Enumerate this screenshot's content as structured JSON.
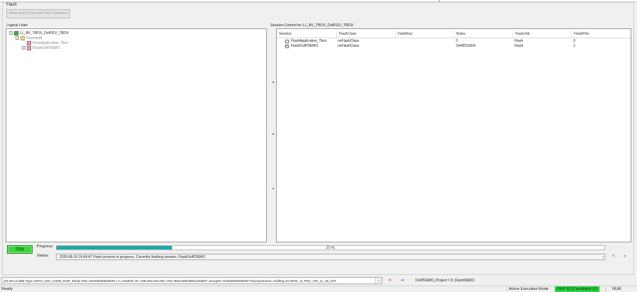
{
  "window": {
    "group_title": "Flash",
    "show_only_button": "Show only ECUs with Flash Sessions"
  },
  "logical_links": {
    "label": "Logical Links",
    "tree": [
      {
        "label": "LL_BV_TBOX_DoIP.EV_TBOX",
        "expander": "−"
      },
      {
        "label": "Download",
        "expander": "−"
      },
      {
        "label": "FlashApplication_Tbox",
        "expander": ""
      },
      {
        "label": "FlashDoIPDEMO",
        "expander": "+"
      }
    ]
  },
  "session_control": {
    "label": "Session Control for LL_BV_TBOX_DoIP.EV_TBOX",
    "columns": [
      "Session",
      "FlashClass",
      "FlashKey",
      "Bytes",
      "FlashJob",
      "FlashPrio"
    ],
    "rows": [
      {
        "checked": false,
        "session": "FlashApplication_Tbox",
        "flashclass": "noFlashClass",
        "flashkey": "",
        "bytes": "0",
        "flashjob": "Flash",
        "flashprio": "0"
      },
      {
        "checked": true,
        "session": "FlashDoIPDEMO",
        "flashclass": "noFlashClass",
        "flashkey": "",
        "bytes": "1549531004",
        "flashjob": "Flash",
        "flashprio": "1"
      }
    ]
  },
  "progress": {
    "stop_label": "Stop",
    "progress_label": "Progress:",
    "percent": 21,
    "percent_text": "21 %",
    "status_label": "Status:",
    "status_text": "2020-06-19 16:49:47  Flash process in progress. Currently flashing session: FlashDoIPDEMO"
  },
  "connection": {
    "text": "[16:49:14.388] Type='MVCI_ISO_13400_DoIP_Entity' EID='0x003030303030' LA='0x0010' IP='169.254.010.001' VIN='BWA45678901234567' GroupID='0x303030303030' PduApiVersion='Softing AG EDIC_D_PDU_API_11_26_072'",
    "project_path": "DoIPDEMO_Project / VI_FlashDEMO"
  },
  "statusbar": {
    "ready": "Ready",
    "execution_mode_label": "Active Execution Mode",
    "execution_mode_value": "DoIP ECU available (1)",
    "num": "NUM"
  },
  "colors": {
    "progress_fill": "#1ea8a8",
    "stop_green": "#3dd33d",
    "badge_green": "#2ecc40"
  },
  "icons": [
    "tree-expander-icon",
    "green-ecu-icon",
    "folder-icon",
    "flash-session-icon",
    "tools-icon",
    "exit-icon"
  ]
}
